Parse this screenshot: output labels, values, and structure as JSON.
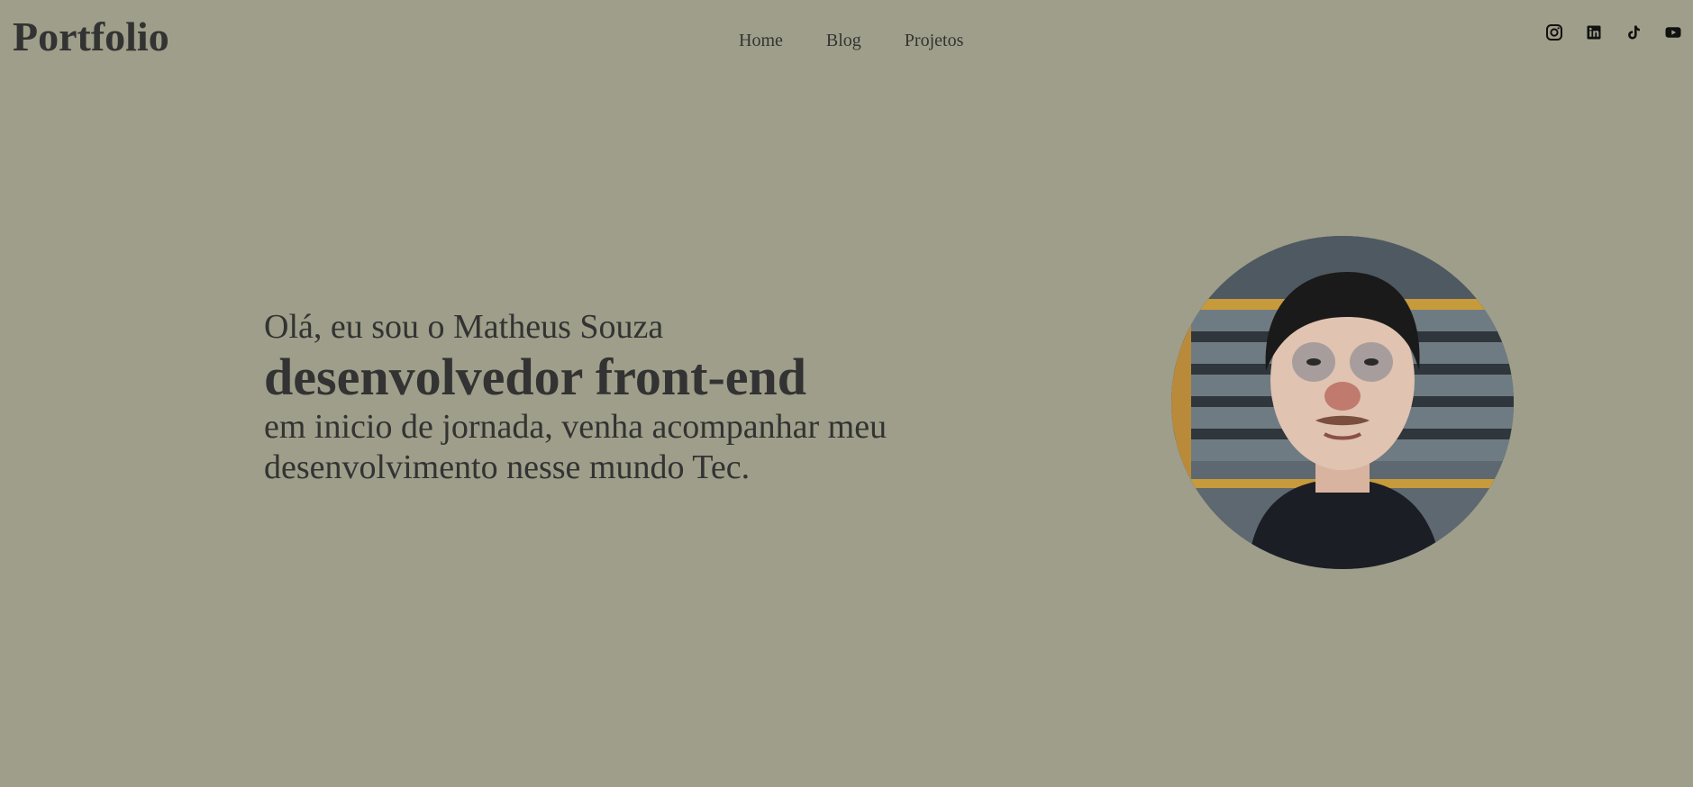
{
  "header": {
    "logo": "Portfolio",
    "nav": {
      "home": "Home",
      "blog": "Blog",
      "projects": "Projetos"
    },
    "social": [
      "instagram-icon",
      "linkedin-icon",
      "tiktok-icon",
      "youtube-icon"
    ]
  },
  "hero": {
    "greeting": "Olá, eu sou o Matheus Souza",
    "role": "desenvolvedor front-end",
    "description": "em inicio de jornada, venha acompanhar meu desenvolvimento nesse mundo Tec."
  },
  "colors": {
    "background": "#9e9e8a",
    "text": "#333333"
  }
}
